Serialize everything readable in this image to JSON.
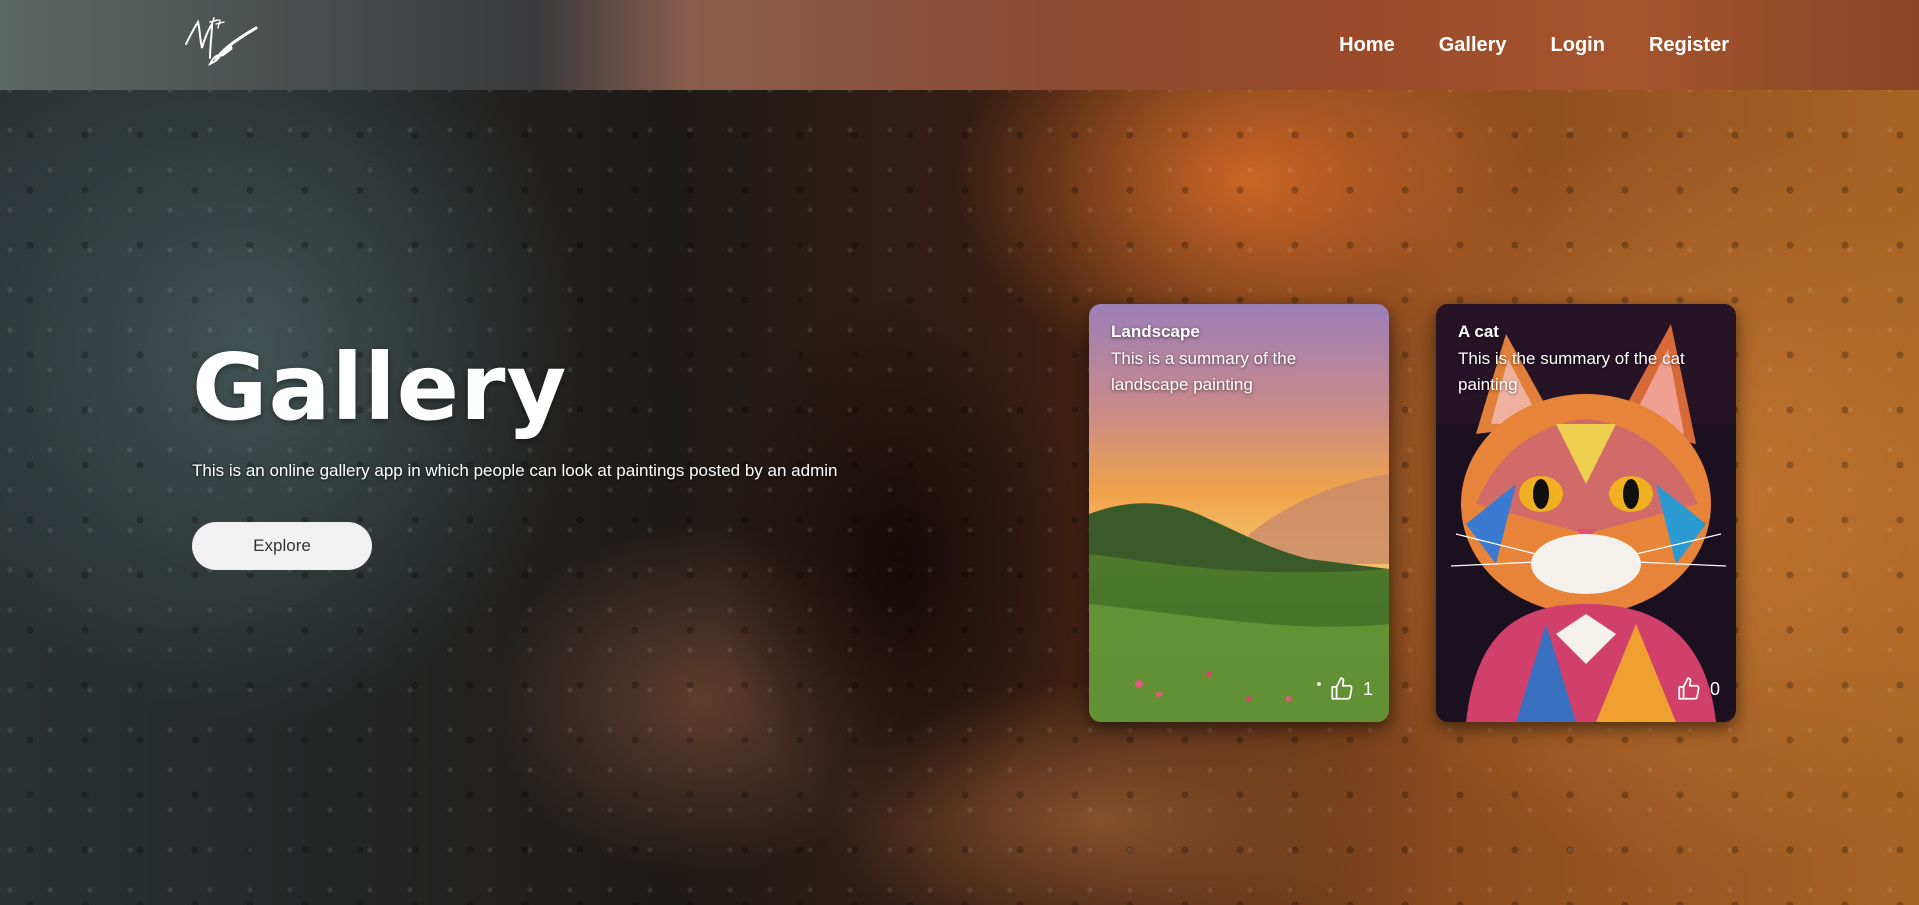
{
  "header": {
    "logo_icon": "art-brush-logo-icon",
    "nav": [
      {
        "label": "Home"
      },
      {
        "label": "Gallery"
      },
      {
        "label": "Login"
      },
      {
        "label": "Register"
      }
    ]
  },
  "hero": {
    "title": "Gallery",
    "subtitle": "This is an online gallery app in which people can look at paintings posted by an admin",
    "cta_label": "Explore"
  },
  "cards": [
    {
      "title": "Landscape",
      "summary": "This is a summary of the landscape painting",
      "likes": "1",
      "like_icon": "thumbs-up-icon"
    },
    {
      "title": "A cat",
      "summary": "This is the summary of the cat painting",
      "likes": "0",
      "like_icon": "thumbs-up-icon"
    }
  ],
  "colors": {
    "header_start": "#5d6763",
    "header_end": "#8a4526",
    "button_bg": "#f1f1f1",
    "text": "#ffffff"
  }
}
